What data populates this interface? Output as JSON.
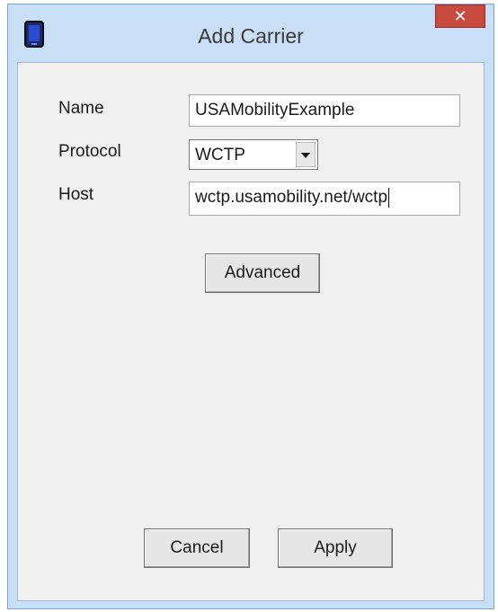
{
  "window": {
    "title": "Add Carrier",
    "close_glyph": "✕",
    "app_icon": "phone-icon"
  },
  "form": {
    "name_label": "Name",
    "name_value": "USAMobilityExample",
    "protocol_label": "Protocol",
    "protocol_value": "WCTP",
    "host_label": "Host",
    "host_value": "wctp.usamobility.net/wctp"
  },
  "buttons": {
    "advanced": "Advanced",
    "cancel": "Cancel",
    "apply": "Apply"
  },
  "colors": {
    "close_button": "#c94a3e",
    "window_frame": "#c9dff5",
    "client_background": "#f0f0f0"
  }
}
